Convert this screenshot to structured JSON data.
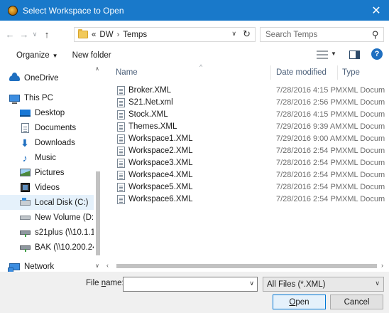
{
  "window": {
    "title": "Select Workspace to Open",
    "close_glyph": "✕"
  },
  "nav": {
    "back_glyph": "←",
    "forward_glyph": "→",
    "recent_glyph": "∨",
    "up_glyph": "↑"
  },
  "address": {
    "overflow": "«",
    "crumbs": [
      "DW",
      "Temps"
    ],
    "separator": "›",
    "dropdown_glyph": "∨",
    "refresh_glyph": "↻"
  },
  "search": {
    "placeholder": "Search Temps",
    "icon_glyph": "⚲"
  },
  "toolbar": {
    "organize_label": "Organize",
    "organize_caret": "▼",
    "new_folder_label": "New folder",
    "view_caret": "▼",
    "help_label": "?"
  },
  "navpane": {
    "up_glyph": "∧",
    "down_glyph": "∨",
    "items": [
      {
        "label": "OneDrive"
      },
      {
        "label": "This PC"
      },
      {
        "label": "Desktop"
      },
      {
        "label": "Documents"
      },
      {
        "label": "Downloads"
      },
      {
        "label": "Music"
      },
      {
        "label": "Pictures"
      },
      {
        "label": "Videos"
      },
      {
        "label": "Local Disk (C:)"
      },
      {
        "label": "New Volume (D:"
      },
      {
        "label": "s21plus (\\\\10.1.1"
      },
      {
        "label": "BAK (\\\\10.200.24"
      },
      {
        "label": "Network"
      }
    ]
  },
  "filelist": {
    "columns": {
      "name": "Name",
      "date": "Date modified",
      "type": "Type"
    },
    "sort_glyph": "^",
    "rows": [
      {
        "name": "Broker.XML",
        "date": "7/28/2016 4:15 PM",
        "type": "XML Docum"
      },
      {
        "name": "S21.Net.xml",
        "date": "7/28/2016 2:56 PM",
        "type": "XML Docum"
      },
      {
        "name": "Stock.XML",
        "date": "7/28/2016 4:15 PM",
        "type": "XML Docum"
      },
      {
        "name": "Themes.XML",
        "date": "7/29/2016 9:39 AM",
        "type": "XML Docum"
      },
      {
        "name": "Workspace1.XML",
        "date": "7/29/2016 9:00 AM",
        "type": "XML Docum"
      },
      {
        "name": "Workspace2.XML",
        "date": "7/28/2016 2:54 PM",
        "type": "XML Docum"
      },
      {
        "name": "Workspace3.XML",
        "date": "7/28/2016 2:54 PM",
        "type": "XML Docum"
      },
      {
        "name": "Workspace4.XML",
        "date": "7/28/2016 2:54 PM",
        "type": "XML Docum"
      },
      {
        "name": "Workspace5.XML",
        "date": "7/28/2016 2:54 PM",
        "type": "XML Docum"
      },
      {
        "name": "Workspace6.XML",
        "date": "7/28/2016 2:54 PM",
        "type": "XML Docum"
      }
    ],
    "hscroll_left": "‹",
    "hscroll_right": "›"
  },
  "bottom": {
    "file_name_prefix": "File ",
    "file_name_key": "n",
    "file_name_suffix": "ame:",
    "file_name_value": "",
    "file_name_dd": "∨",
    "file_type": "All Files (*.XML)",
    "file_type_dd": "∨",
    "open_key": "O",
    "open_rest": "pen",
    "cancel_label": "Cancel"
  },
  "colors": {
    "titlebar": "#1979ca",
    "selection": "#cce8ff",
    "accent": "#0078d7"
  }
}
